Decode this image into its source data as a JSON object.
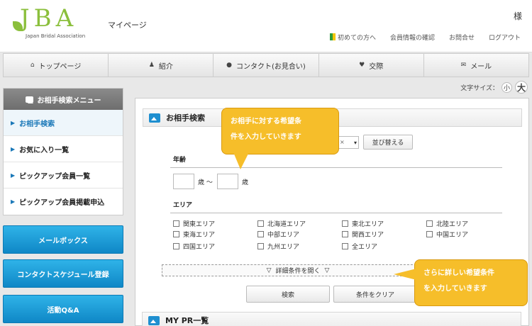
{
  "header": {
    "logo_text": "JBA",
    "logo_sub": "Japan Bridal Association",
    "mypage": "マイページ",
    "sama": "様",
    "links": [
      "初めての方へ",
      "会員情報の確認",
      "お問合せ",
      "ログアウト"
    ]
  },
  "nav": [
    {
      "icon": "home-icon",
      "glyph": "⌂",
      "label": "トップページ"
    },
    {
      "icon": "user-icon",
      "glyph": "♟",
      "label": "紹介"
    },
    {
      "icon": "chat-icon",
      "glyph": "●",
      "label": "コンタクト(お見合い)"
    },
    {
      "icon": "heart-icon",
      "glyph": "♥",
      "label": "交際"
    },
    {
      "icon": "mail-icon",
      "glyph": "✉",
      "label": "メール"
    }
  ],
  "fontsize": {
    "label": "文字サイズ：",
    "small": "小",
    "large": "大"
  },
  "side": {
    "head": "お相手検索メニュー",
    "items": [
      "お相手検索",
      "お気に入り一覧",
      "ピックアップ会員一覧",
      "ピックアップ会員掲載申込"
    ],
    "buttons": [
      "メールボックス",
      "コンタクトスケジュール登録",
      "活動Q&A"
    ]
  },
  "search": {
    "title": "お相手検索",
    "sort_button": "並び替える",
    "age_label": "年齢",
    "age_unit1": "歳 ～",
    "age_unit2": "歳",
    "area_label": "エリア",
    "areas": [
      "関東エリア",
      "北海道エリア",
      "東北エリア",
      "北陸エリア",
      "東海エリア",
      "中部エリア",
      "関西エリア",
      "中国エリア",
      "四国エリア",
      "九州エリア",
      "全エリア"
    ],
    "detail": "詳細条件を開く",
    "search_btn": "検索",
    "clear_btn": "条件をクリア"
  },
  "pr": {
    "title": "MY PR一覧"
  },
  "callouts": {
    "one": [
      "お相手に対する希望条",
      "件を入力していきます"
    ],
    "two": [
      "さらに詳しい希望条件",
      "を入力していきます"
    ]
  }
}
